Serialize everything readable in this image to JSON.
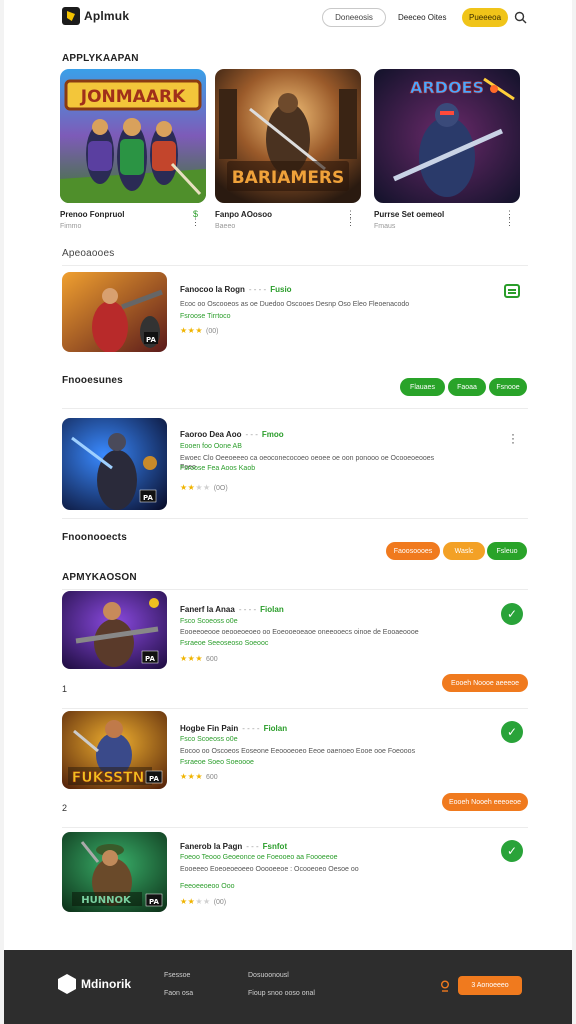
{
  "header": {
    "logo_text": "Aplmuk",
    "outline_button": "Doneeosis",
    "link": "Deeceo Oites",
    "yellow_button": "Pueeeoa"
  },
  "featured": {
    "title": "APPLYKAAPAN",
    "cards": [
      {
        "art_title": "JONMAARK",
        "title": "Prenoo Fonpruol",
        "sub": "Fimmo"
      },
      {
        "art_title": "BARIAMERS",
        "title": "Fanpo AOosoo",
        "sub": "Baeeo"
      },
      {
        "art_title": "ARDOES",
        "title": "Purrse Set oemeol",
        "sub": "Fmaus"
      }
    ]
  },
  "section1": {
    "title": "Apeoaooes",
    "item": {
      "title": "Fanocoo la Rogn",
      "dev": "- - - -",
      "tag": "Fusio",
      "desc": "Ecoc oo Oscooeos as oe Duedoo Oscooes Desnp Oso Eleo Fleoenacodo",
      "green": "Fsroose Tirrtoco",
      "rating": 3,
      "count": "(00)",
      "badge": "PA"
    }
  },
  "section2": {
    "title": "Fnooesunes",
    "pills": [
      "Flauaes",
      "Faoaa",
      "Fsnooe"
    ],
    "item": {
      "title": "Faoroo Dea Aoo",
      "dev": "- - -",
      "tag": "Fmoo",
      "desc_1": "Eooen foo Oone AB",
      "desc_2": "Ewoec Clo Oeeoeeeo ca oeoconecocoeo oeoee oe oon ponooo oe Ocooeoeooes Foeo",
      "green": "Fsroose Fea Aoos Kaob",
      "rating": 2,
      "count": "(0O)",
      "badge": "PA"
    }
  },
  "section3": {
    "title": "Fnoonooects",
    "pills": [
      "Faoosoooes",
      "Waslc",
      "Fsleuo"
    ]
  },
  "section4": {
    "title": "APMYKAOSON",
    "items": [
      {
        "rank": "",
        "title": "Fanerf la Anaa",
        "dev": "- - - -",
        "tag": "Fiolan",
        "green_1": "Fsco Scoeoss o0e",
        "desc": "Eooeeoeooe oeooeoeoeo oo Eoeooeoeaoe oneeooecs oinoe de Eooaeoooe",
        "green_2": "Fsraeoe Seeoseoso Soeooc",
        "rating": 3,
        "count": "600",
        "badge": "PA",
        "action": "Eooeh Noooe aeeeoe"
      },
      {
        "rank": "1",
        "title": "Hogbe Fin Pain",
        "dev": "- - - -",
        "tag": "Fiolan",
        "green_1": "Fsco Scoeoss o0e",
        "desc": "Eocoo oo Oscoeos Eoseone Eeoooeoeo Eeoe oaenoeo Eooe ooe Foeooos",
        "green_2": "Fsraeoe Soeo Soeoooe",
        "rating": 3,
        "count": "600",
        "badge": "PA",
        "action": "Eooeh Nooeh eeeoeoe"
      },
      {
        "rank": "2",
        "title": "Fanerob la Pagn",
        "dev": "- - -",
        "tag": "Fsnfot",
        "green_1": "Foeoo Teooo Geoeonce oe Foeooeo aa Foooeeoe",
        "desc": "Eooeeeo Eoeoeoeoeeo Ooooeeoe : Ocooeoeo Oesoe oo",
        "green_2": "Feeoeeoeoo Ooo",
        "rating": 2,
        "count": "(00)",
        "badge": "PA"
      }
    ]
  },
  "footer": {
    "logo_text": "Mdinorik",
    "links": [
      "Fsessoe",
      "Faon osa",
      "Dosuoonousl",
      "Fioup snoo ooso onal"
    ],
    "button": "3 Aonoeeeo"
  }
}
